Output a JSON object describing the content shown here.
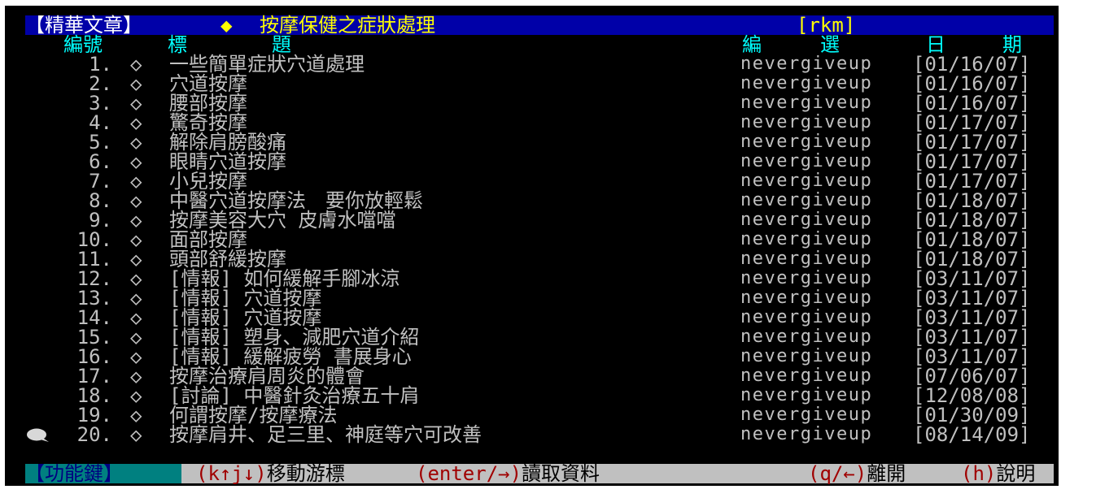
{
  "title_bar": {
    "board_label": "【精華文章】",
    "diamond": "◆",
    "title": "按摩保健之症狀處理",
    "tag": "[rkm]"
  },
  "columns": {
    "number": "編號",
    "title_a": "標",
    "title_b": "題",
    "editor_a": "編",
    "editor_b": "選",
    "date_a": "日",
    "date_b": "期"
  },
  "rows": [
    {
      "num": "1.",
      "mark": "◇",
      "title": "一些簡單症狀穴道處理",
      "author": "nevergiveup",
      "date": "[01/16/07]"
    },
    {
      "num": "2.",
      "mark": "◇",
      "title": "穴道按摩",
      "author": "nevergiveup",
      "date": "[01/16/07]"
    },
    {
      "num": "3.",
      "mark": "◇",
      "title": "腰部按摩",
      "author": "nevergiveup",
      "date": "[01/16/07]"
    },
    {
      "num": "4.",
      "mark": "◇",
      "title": "驚奇按摩",
      "author": "nevergiveup",
      "date": "[01/17/07]"
    },
    {
      "num": "5.",
      "mark": "◇",
      "title": "解除肩膀酸痛",
      "author": "nevergiveup",
      "date": "[01/17/07]"
    },
    {
      "num": "6.",
      "mark": "◇",
      "title": "眼睛穴道按摩",
      "author": "nevergiveup",
      "date": "[01/17/07]"
    },
    {
      "num": "7.",
      "mark": "◇",
      "title": "小兒按摩",
      "author": "nevergiveup",
      "date": "[01/17/07]"
    },
    {
      "num": "8.",
      "mark": "◇",
      "title": "中醫穴道按摩法　要你放輕鬆",
      "author": "nevergiveup",
      "date": "[01/18/07]"
    },
    {
      "num": "9.",
      "mark": "◇",
      "title": "按摩美容大穴 皮膚水噹噹",
      "author": "nevergiveup",
      "date": "[01/18/07]"
    },
    {
      "num": "10.",
      "mark": "◇",
      "title": "面部按摩",
      "author": "nevergiveup",
      "date": "[01/18/07]"
    },
    {
      "num": "11.",
      "mark": "◇",
      "title": "頭部舒緩按摩",
      "author": "nevergiveup",
      "date": "[01/18/07]"
    },
    {
      "num": "12.",
      "mark": "◇",
      "title": "[情報] 如何緩解手腳冰涼",
      "author": "nevergiveup",
      "date": "[03/11/07]"
    },
    {
      "num": "13.",
      "mark": "◇",
      "title": "[情報] 穴道按摩",
      "author": "nevergiveup",
      "date": "[03/11/07]"
    },
    {
      "num": "14.",
      "mark": "◇",
      "title": "[情報] 穴道按摩",
      "author": "nevergiveup",
      "date": "[03/11/07]"
    },
    {
      "num": "15.",
      "mark": "◇",
      "title": "[情報] 塑身、減肥穴道介紹",
      "author": "nevergiveup",
      "date": "[03/11/07]"
    },
    {
      "num": "16.",
      "mark": "◇",
      "title": "[情報] 緩解疲勞 書展身心",
      "author": "nevergiveup",
      "date": "[03/11/07]"
    },
    {
      "num": "17.",
      "mark": "◇",
      "title": "按摩治療肩周炎的體會",
      "author": "nevergiveup",
      "date": "[07/06/07]"
    },
    {
      "num": "18.",
      "mark": "◇",
      "title": "[討論] 中醫針灸治療五十肩",
      "author": "nevergiveup",
      "date": "[12/08/08]"
    },
    {
      "num": "19.",
      "mark": "◇",
      "title": " 何謂按摩/按摩療法",
      "author": "nevergiveup",
      "date": "[01/30/09]"
    },
    {
      "num": "20.",
      "mark": "◇",
      "title": "按摩肩井、足三里、神庭等穴可改善",
      "author": "nevergiveup",
      "date": "[08/14/09]"
    }
  ],
  "footer": {
    "key_label": "【功能鍵】",
    "move_key": "(k↑j↓)",
    "move_label": "移動游標",
    "read_key": "(enter/→)",
    "read_label": "讀取資料",
    "leave_key": "(q/←)",
    "leave_label": "離開",
    "help_key": "(h)",
    "help_label": "說明"
  },
  "colors": {
    "title_bar_bg": "#0000a8",
    "title_text": "#ffff00",
    "header_text": "#00ffff",
    "row_text": "#c0c0c0",
    "footer_bg": "#c0c0c0",
    "footer_key_bg": "#008080",
    "footer_hotkey": "#a00000"
  },
  "cursor": {
    "icon": "speech-bubble-icon",
    "row_index": 19
  }
}
